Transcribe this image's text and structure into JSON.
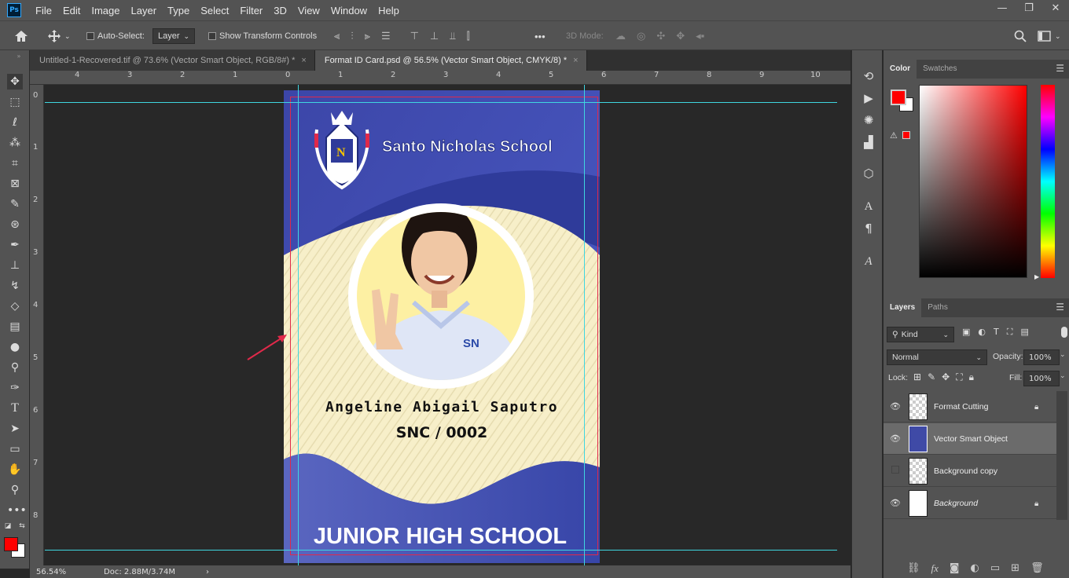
{
  "app": {
    "logo": "Ps"
  },
  "menu": [
    "File",
    "Edit",
    "Image",
    "Layer",
    "Type",
    "Select",
    "Filter",
    "3D",
    "View",
    "Window",
    "Help"
  ],
  "window_controls": {
    "minimize": "—",
    "restore": "❐",
    "close": "✕"
  },
  "options": {
    "auto_select_label": "Auto-Select:",
    "auto_select_target": "Layer",
    "transform_controls_label": "Show Transform Controls",
    "mode_3d_label": "3D Mode:",
    "more_label": "•••"
  },
  "tabs": [
    {
      "label": "Untitled-1-Recovered.tif @ 73.6% (Vector Smart Object, RGB/8#) *",
      "close": "×"
    },
    {
      "label": "Format ID Card.psd @ 56.5% (Vector Smart Object, CMYK/8) *",
      "close": "×"
    }
  ],
  "ruler_h": [
    "4",
    "3",
    "2",
    "1",
    "0",
    "1",
    "2",
    "3",
    "4",
    "5",
    "6",
    "7",
    "8",
    "9",
    "10"
  ],
  "ruler_v": [
    "0",
    "1",
    "2",
    "3",
    "4",
    "5",
    "6",
    "7",
    "8"
  ],
  "card": {
    "school_name": "Santo Nicholas School",
    "crest_letters": "N",
    "student_name": "Angeline Abigail Saputro",
    "student_id": "SNC / 0002",
    "level": "JUNIOR HIGH SCHOOL",
    "shirt_logo": "SN",
    "colors": {
      "primary": "#3f4aa6",
      "cream": "#f7efc9",
      "photo_bg": "#fdf0a3",
      "guide": "#3fd6e0",
      "bleed": "#e0294a"
    }
  },
  "status": {
    "zoom": "56.54%",
    "doc": "Doc: 2.88M/3.74M",
    "arrow": "›"
  },
  "color_panel": {
    "tabs": [
      "Color",
      "Swatches"
    ],
    "fg": "#ff0000",
    "bg": "#ffffff"
  },
  "layers_panel": {
    "tabs": [
      "Layers",
      "Paths"
    ],
    "kind_label": "Kind",
    "blend_mode": "Normal",
    "opacity_label": "Opacity:",
    "opacity": "100%",
    "lock_label": "Lock:",
    "fill_label": "Fill:",
    "fill": "100%",
    "layers": [
      {
        "name": "Format Cutting",
        "visible": true,
        "locked": true
      },
      {
        "name": "Vector Smart Object",
        "visible": true,
        "locked": false,
        "selected": true
      },
      {
        "name": "Background copy",
        "visible": false,
        "locked": false
      },
      {
        "name": "Background",
        "visible": true,
        "locked": true
      }
    ]
  }
}
